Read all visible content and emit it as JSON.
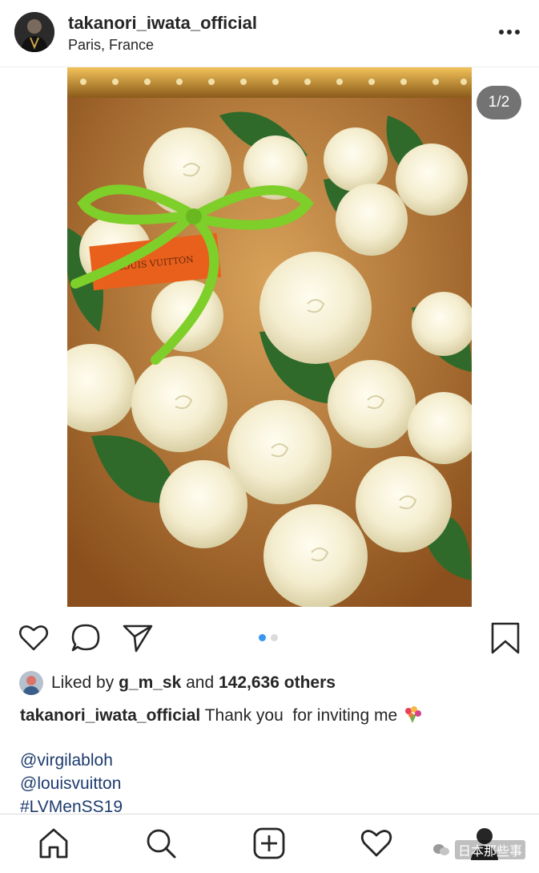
{
  "post": {
    "username": "takanori_iwata_official",
    "location": "Paris, France",
    "image_counter": "1/2",
    "image_subject": "white roses bouquet with green ribbon and orange LOUIS VUITTON tag",
    "tag_text": "LOUIS VUITTON"
  },
  "carousel": {
    "total": 2,
    "active": 1,
    "active_color": "#3897f0",
    "inactive_color": "#dbdbdb"
  },
  "likes": {
    "prefix": "Liked by ",
    "user": "g_m_sk",
    "middle": " and ",
    "count": "142,636 others"
  },
  "caption": {
    "username": "takanori_iwata_official",
    "text": " Thank you  for inviting me",
    "emoji": "bouquet-emoji"
  },
  "mentions": [
    "@virgilabloh",
    "@louisvuitton",
    "#LVMenSS19"
  ],
  "actions": [
    "heart-icon",
    "comment-icon",
    "share-icon",
    "bookmark-icon"
  ],
  "nav": [
    "home-icon",
    "search-icon",
    "add-post-icon",
    "activity-heart-icon",
    "profile-icon"
  ],
  "watermark": {
    "text": "日本那些事"
  },
  "colors": {
    "link": "#1d3b6e",
    "text": "#262626"
  }
}
